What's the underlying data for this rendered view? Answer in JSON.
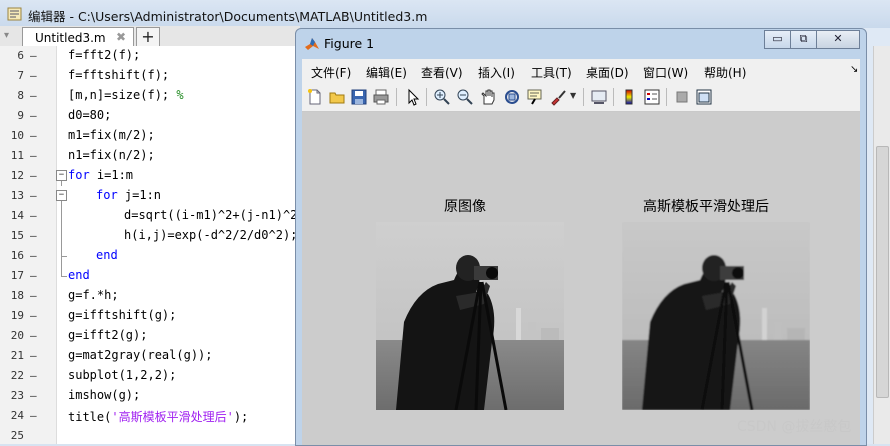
{
  "editor": {
    "title": "编辑器 - C:\\Users\\Administrator\\Documents\\MATLAB\\Untitled3.m",
    "tab_label": "Untitled3.m",
    "tab_close": "✖",
    "tab_add": "+",
    "lines": [
      {
        "num": "6",
        "text": "f=fft2(f);"
      },
      {
        "num": "7",
        "text": "f=fftshift(f);"
      },
      {
        "num": "8",
        "text": "[m,n]=size(f);",
        "comment": "%"
      },
      {
        "num": "9",
        "text": "d0=80;"
      },
      {
        "num": "10",
        "text": "m1=fix(m/2);"
      },
      {
        "num": "11",
        "text": "n1=fix(n/2);"
      },
      {
        "num": "12",
        "kw": "for",
        "text": " i=1:m"
      },
      {
        "num": "13",
        "kw": "for",
        "text": " j=1:n"
      },
      {
        "num": "14",
        "text": "d=sqrt((i-m1)^2+(j-n1)^2"
      },
      {
        "num": "15",
        "text": "h(i,j)=exp(-d^2/2/d0^2);"
      },
      {
        "num": "16",
        "kw": "end",
        "text": ""
      },
      {
        "num": "17",
        "kw": "end",
        "text": ""
      },
      {
        "num": "18",
        "text": "g=f.*h;"
      },
      {
        "num": "19",
        "text": "g=ifftshift(g);"
      },
      {
        "num": "20",
        "text": "g=ifft2(g);"
      },
      {
        "num": "21",
        "text": "g=mat2gray(real(g));"
      },
      {
        "num": "22",
        "text": "subplot(1,2,2);"
      },
      {
        "num": "23",
        "text": "imshow(g);"
      },
      {
        "num": "24",
        "text": "title(",
        "str": "'高斯模板平滑处理后'",
        "tail": ");"
      },
      {
        "num": "25",
        "text": ""
      }
    ]
  },
  "figure": {
    "title": "Figure 1",
    "window_buttons": {
      "minimize": "▭",
      "restore": "⧉",
      "close": "✕"
    },
    "menus": [
      "文件(F)",
      "编辑(E)",
      "查看(V)",
      "插入(I)",
      "工具(T)",
      "桌面(D)",
      "窗口(W)",
      "帮助(H)"
    ],
    "menu_arrow": "↘",
    "toolbar_icons": [
      "new-figure-icon",
      "open-icon",
      "save-icon",
      "print-icon",
      "pointer-icon",
      "zoom-in-icon",
      "zoom-out-icon",
      "pan-icon",
      "rotate-icon",
      "data-cursor-icon",
      "brush-icon",
      "link-icon",
      "colorbar-icon",
      "legend-icon",
      "hide-tools-icon",
      "show-tools-icon"
    ],
    "subplot_titles": [
      "原图像",
      "高斯模板平滑处理后"
    ]
  },
  "watermark": "CSDN @拔丝憨包",
  "colors": {
    "keyword": "#0000ff",
    "string": "#a020f0",
    "comment": "#228b22"
  }
}
